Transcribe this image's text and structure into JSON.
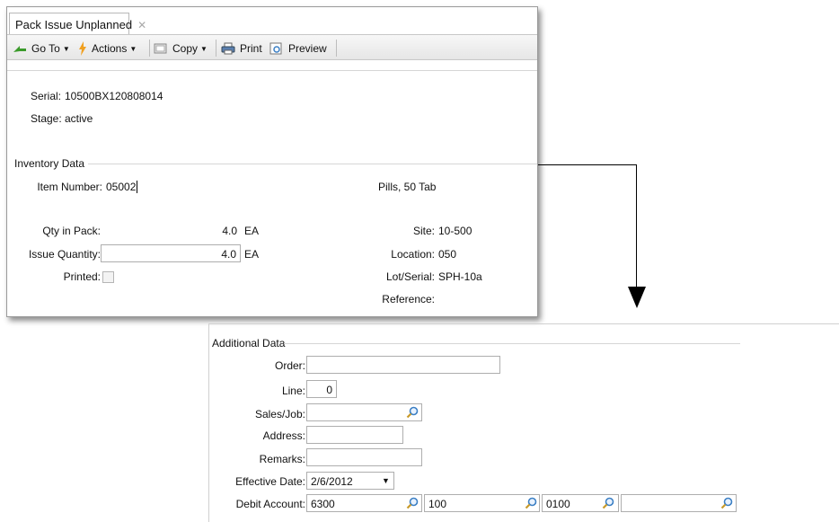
{
  "window": {
    "tab_title": "Pack Issue Unplanned",
    "tab_close": "✕",
    "toolbar": {
      "goto_label": "Go To",
      "actions_label": "Actions",
      "copy_label": "Copy",
      "print_label": "Print",
      "preview_label": "Preview"
    },
    "header": {
      "serial_label": "Serial:",
      "serial_value": "10500BX120808014",
      "stage_label": "Stage:",
      "stage_value": "active"
    },
    "inventory": {
      "group_title": "Inventory Data",
      "item_number_label": "Item Number:",
      "item_number_value": "05002",
      "item_description": "Pills, 50 Tab",
      "qty_in_pack_label": "Qty in Pack:",
      "qty_in_pack_value": "4.0",
      "qty_in_pack_uom": "EA",
      "issue_qty_label": "Issue Quantity:",
      "issue_qty_value": "4.0",
      "issue_qty_uom": "EA",
      "printed_label": "Printed:",
      "printed_checked": false,
      "site_label": "Site:",
      "site_value": "10-500",
      "location_label": "Location:",
      "location_value": "050",
      "lot_serial_label": "Lot/Serial:",
      "lot_serial_value": "SPH-10a",
      "reference_label": "Reference:",
      "reference_value": ""
    }
  },
  "additional": {
    "group_title": "Additional Data",
    "order_label": "Order:",
    "order_value": "",
    "line_label": "Line:",
    "line_value": "0",
    "sales_job_label": "Sales/Job:",
    "sales_job_value": "",
    "address_label": "Address:",
    "address_value": "",
    "remarks_label": "Remarks:",
    "remarks_value": "",
    "effective_date_label": "Effective Date:",
    "effective_date_value": "2/6/2012",
    "debit_account_label": "Debit Account:",
    "debit_account_value": "6300",
    "debit_sub_value": "100",
    "debit_cc_value": "0100",
    "debit_project_value": ""
  },
  "colors": {
    "lookup_icon": "#3b7fc4",
    "goto_icon": "#3a9a2a",
    "actions_icon": "#f0a020"
  }
}
